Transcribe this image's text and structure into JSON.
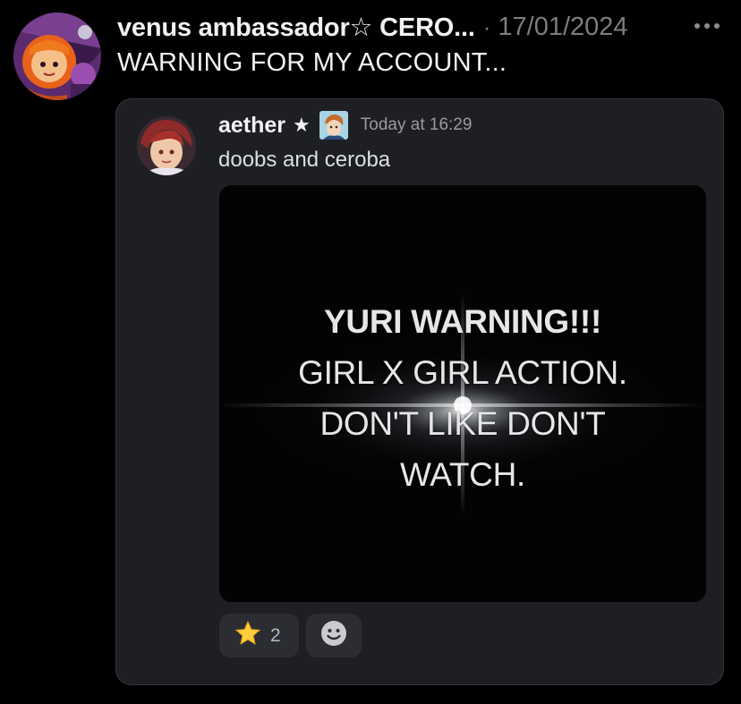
{
  "post": {
    "author": "venus ambassador☆ CERO...",
    "separator": "·",
    "date": "17/01/2024",
    "text": "WARNING FOR MY ACCOUNT..."
  },
  "embed": {
    "author": "aether",
    "author_badge": "★",
    "timestamp": "Today at 16:29",
    "text": "doobs and ceroba",
    "image_lines": [
      "YURI WARNING!!!",
      "GIRL X GIRL ACTION.",
      "DON'T LIKE DON'T",
      "WATCH."
    ],
    "reactions": [
      {
        "emoji": "star-emoji-icon",
        "count": "2"
      }
    ],
    "add_reaction_icon": "smiley-face-icon"
  },
  "colors": {
    "background": "#000000",
    "card_background": "#1e1f23",
    "card_border": "#35363c",
    "reaction_background": "#2b2d33",
    "muted_text": "#7c7c82"
  }
}
